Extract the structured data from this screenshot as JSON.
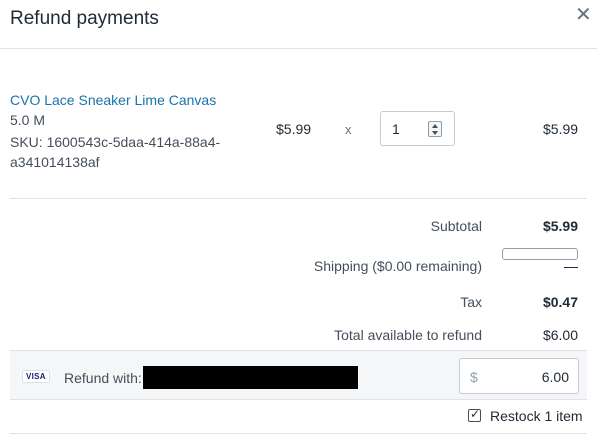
{
  "modal": {
    "title": "Refund payments",
    "close_icon": "close-icon"
  },
  "line_item": {
    "product_name": "CVO Lace Sneaker Lime Canvas",
    "variant": "5.0 M",
    "sku": "SKU: 1600543c-5daa-414a-88a4-a341014138af",
    "unit_price": "$5.99",
    "times": "x",
    "quantity": "1",
    "line_total": "$5.99"
  },
  "summary": {
    "subtotal_label": "Subtotal",
    "subtotal_value": "$5.99",
    "shipping_label": "Shipping ($0.00 remaining)",
    "shipping_value": "",
    "tax_label": "Tax",
    "tax_value": "$0.47",
    "total_label": "Total available to refund",
    "total_value": "$6.00"
  },
  "refund": {
    "card_brand": "VISA",
    "label": "Refund with:",
    "currency_prefix": "$",
    "amount": "6.00"
  },
  "restock": {
    "checked": true,
    "label": "Restock 1 item"
  }
}
